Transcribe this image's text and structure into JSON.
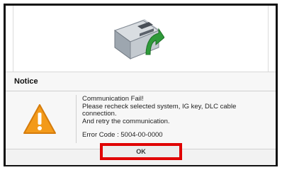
{
  "dialog": {
    "title": "Notice",
    "message_lines": [
      "Communication Fail!",
      "Please recheck selected system, IG key, DLC cable",
      "connection.",
      "And retry the communication."
    ],
    "error_code": "Error Code : 5004-00-0000",
    "ok_label": "OK"
  },
  "colors": {
    "highlight": "#e00000",
    "warning_fill": "#f39a1a",
    "arrow_green": "#2f9a3a"
  },
  "icons": {
    "ecu": "ecu-module-icon",
    "warning": "warning-triangle-icon"
  }
}
